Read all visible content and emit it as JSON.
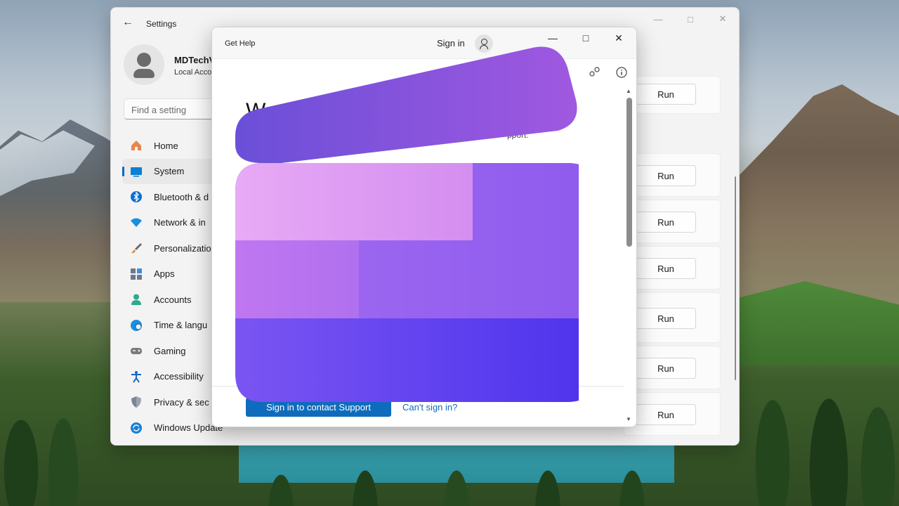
{
  "settings": {
    "title": "Settings",
    "back_icon": "back-arrow-icon",
    "profile": {
      "name": "MDTechV",
      "subtitle": "Local Acco"
    },
    "search_placeholder": "Find a setting",
    "nav": [
      {
        "label": "Home",
        "icon": "home-icon",
        "color": "#e07a3f"
      },
      {
        "label": "System",
        "icon": "system-icon",
        "color": "#0a7fd4",
        "active": true
      },
      {
        "label": "Bluetooth & d",
        "icon": "bluetooth-icon",
        "color": "#0a6fd0"
      },
      {
        "label": "Network & in",
        "icon": "network-icon",
        "color": "#1a8ee0"
      },
      {
        "label": "Personalizatio",
        "icon": "brush-icon",
        "color": "#c8703a"
      },
      {
        "label": "Apps",
        "icon": "apps-icon",
        "color": "#5c6a7a"
      },
      {
        "label": "Accounts",
        "icon": "accounts-icon",
        "color": "#2eaa8c"
      },
      {
        "label": "Time & langu",
        "icon": "globe-icon",
        "color": "#1a8ee0"
      },
      {
        "label": "Gaming",
        "icon": "gamepad-icon",
        "color": "#6b6b6b"
      },
      {
        "label": "Accessibility",
        "icon": "accessibility-icon",
        "color": "#1066c6"
      },
      {
        "label": "Privacy & sec",
        "icon": "shield-icon",
        "color": "#6b7280"
      },
      {
        "label": "Windows Update",
        "icon": "update-icon",
        "color": "#1a7fd6"
      }
    ],
    "run_label": "Run"
  },
  "gethelp": {
    "title": "Get Help",
    "sign_in_label": "Sign in",
    "welcome_fragment": "W",
    "subtitle_fragment": "pport.",
    "primary_button": "Sign in to contact Support",
    "link": "Can't sign in?"
  },
  "colors": {
    "accent": "#0f6cbd",
    "logo_top": "#7a52e0",
    "logo_light": "#e6a8f2",
    "logo_mid": "#a36cf0",
    "logo_bottom": "#5a3ef0"
  }
}
